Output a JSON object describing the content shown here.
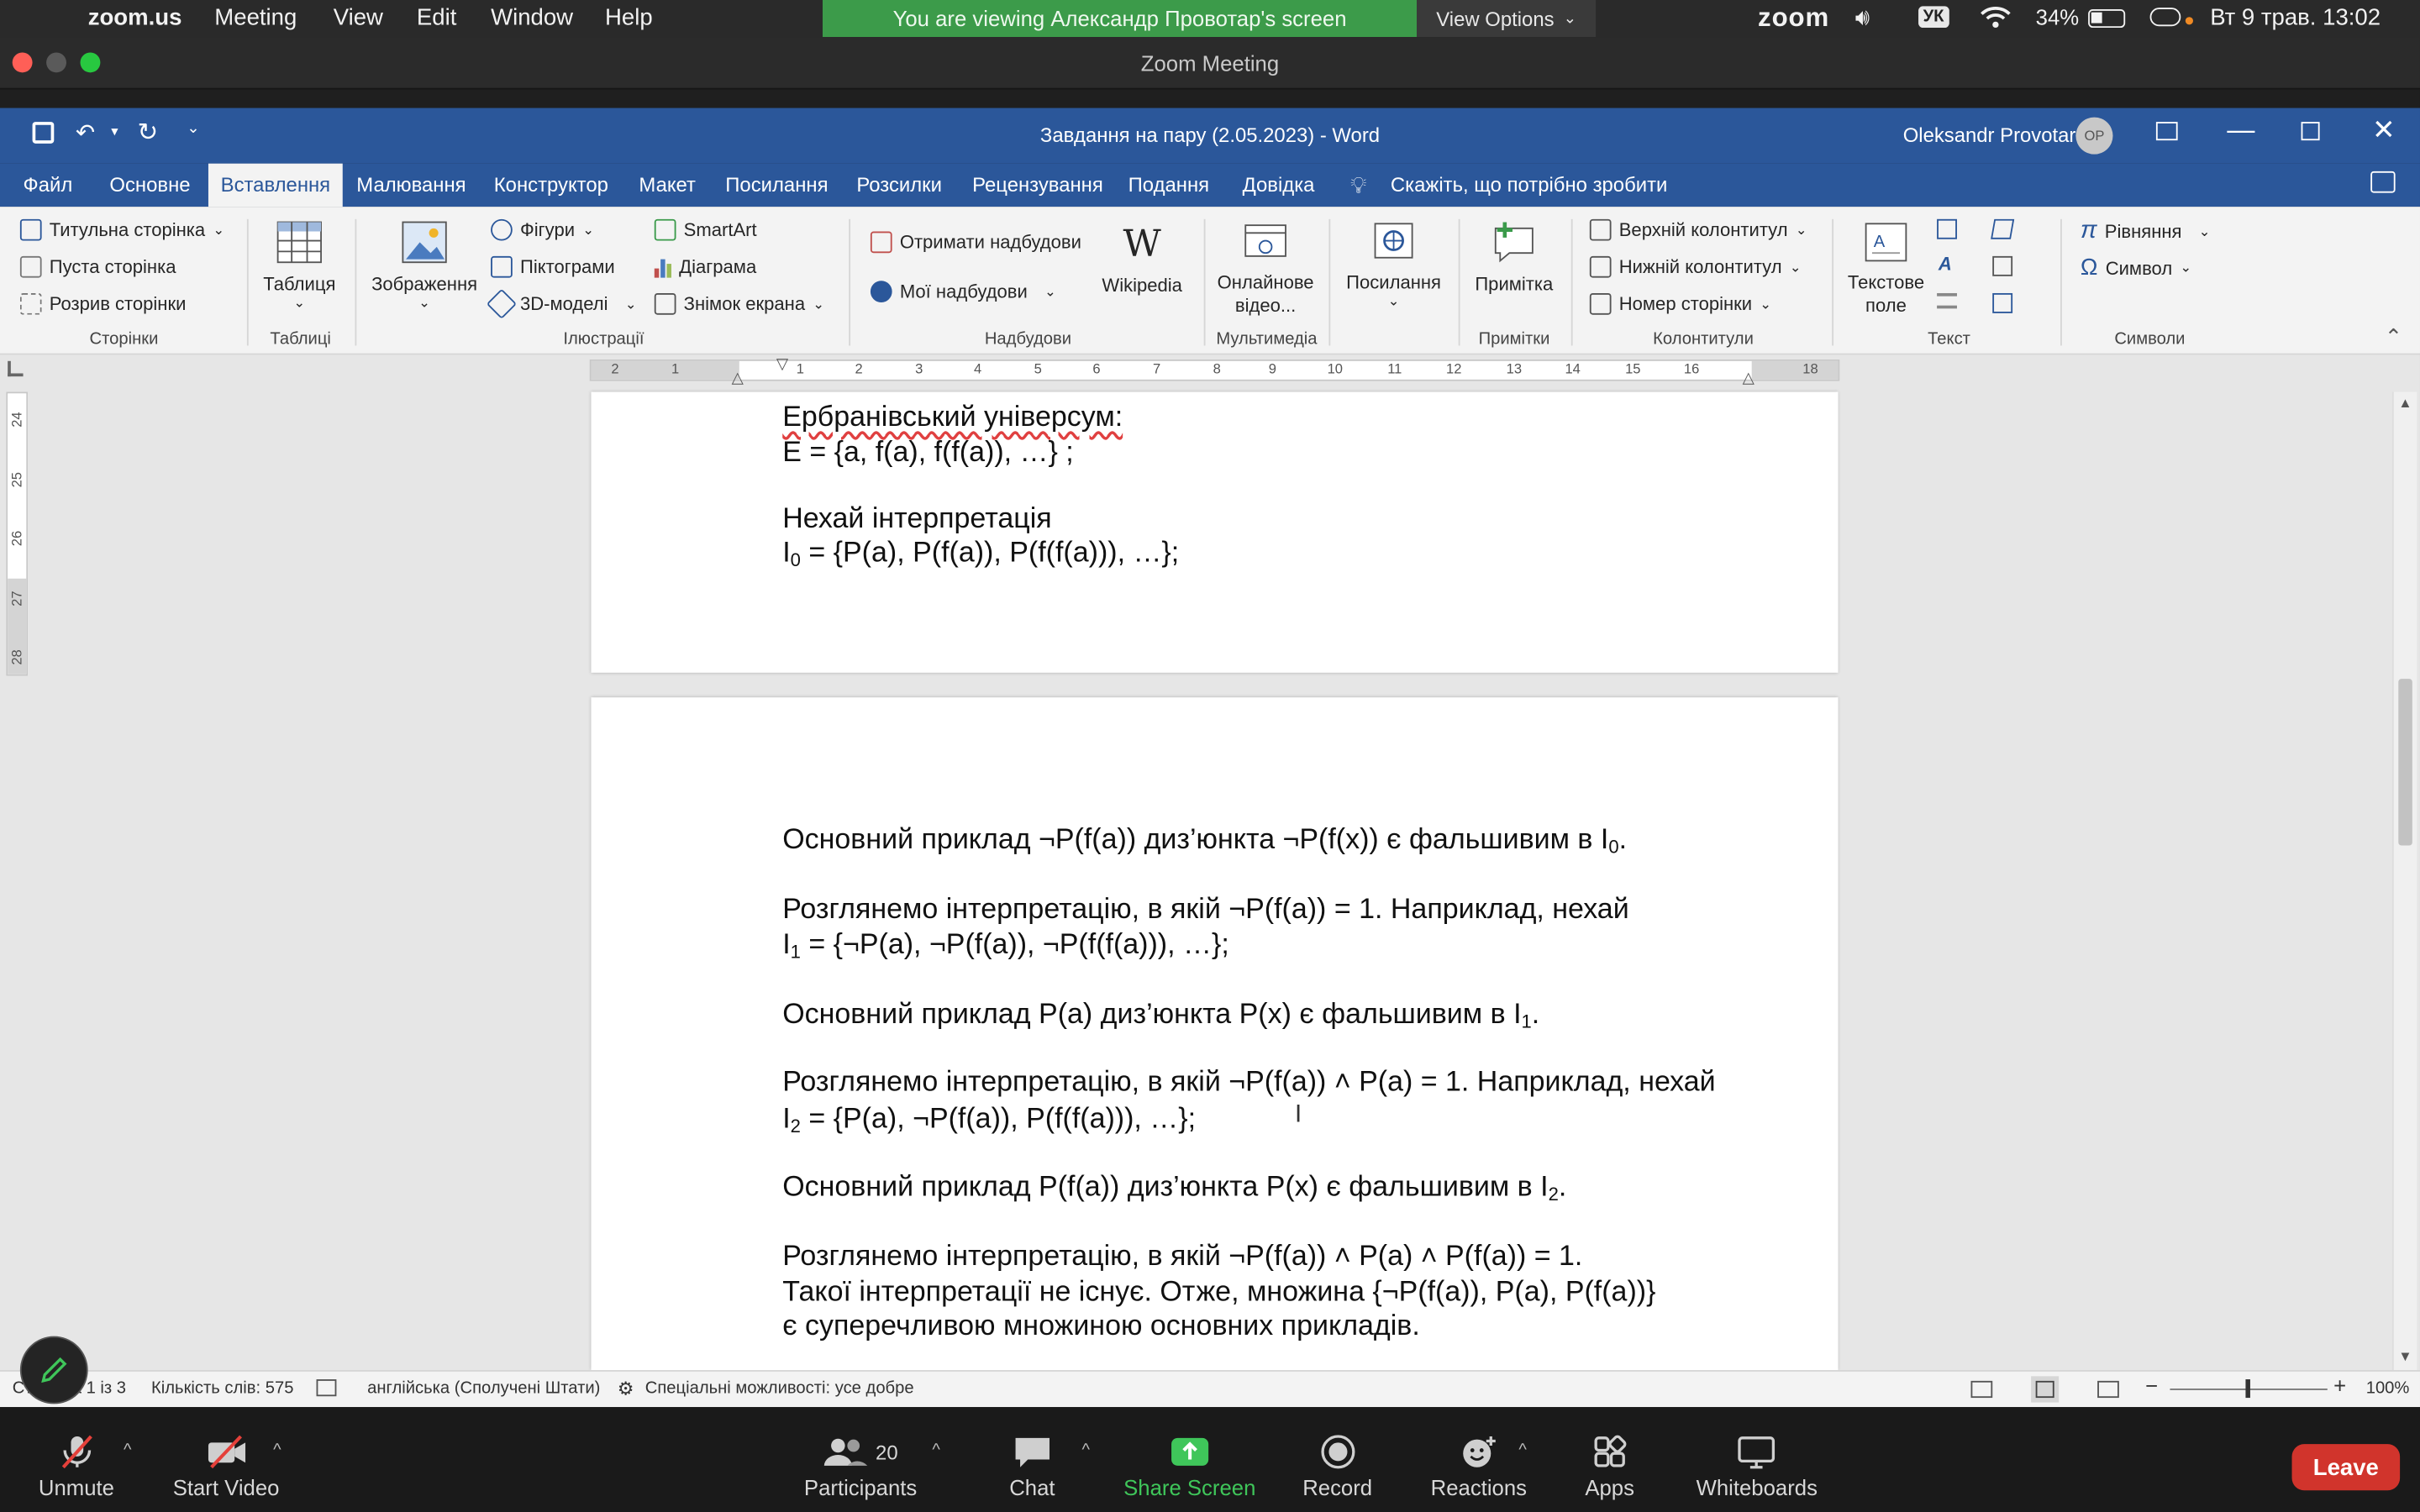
{
  "menubar": {
    "app": "zoom.us",
    "items": [
      "Meeting",
      "View",
      "Edit",
      "Window",
      "Help"
    ],
    "banner": "You are viewing Александр Провотар's screen",
    "view_options": "View Options",
    "zoom_logo": "zoom",
    "input_lang": "УК",
    "battery": "34%",
    "datetime": "Вт 9 трав.  13:02"
  },
  "zoom_window": {
    "title": "Zoom Meeting"
  },
  "word": {
    "title": "Завдання на пару (2.05.2023)  -  Word",
    "user": "Oleksandr Provotar",
    "user_initials": "OP"
  },
  "tabs": [
    "Файл",
    "Основне",
    "Вставлення",
    "Малювання",
    "Конструктор",
    "Макет",
    "Посилання",
    "Розсилки",
    "Рецензування",
    "Подання",
    "Довідка"
  ],
  "tell_me": "Скажіть, що потрібно зробити",
  "ribbon": {
    "pages": {
      "cover": "Титульна сторінка",
      "blank": "Пуста сторінка",
      "break": "Розрив сторінки",
      "group": "Сторінки"
    },
    "tables": {
      "table": "Таблиця",
      "group": "Таблиці"
    },
    "illustrations": {
      "pictures": "Зображення",
      "shapes": "Фігури",
      "icons": "Піктограми",
      "models3d": "3D-моделі",
      "smartart": "SmartArt",
      "chart": "Діаграма",
      "screenshot": "Знімок екрана",
      "group": "Ілюстрації"
    },
    "addins": {
      "get": "Отримати надбудови",
      "my": "Мої надбудови",
      "wikipedia": "Wikipedia",
      "group": "Надбудови"
    },
    "media": {
      "online_video": "Онлайнове відео...",
      "group": "Мультимедіа"
    },
    "links": {
      "link": "Посилання"
    },
    "comments": {
      "comment": "Примітка",
      "group": "Примітки"
    },
    "header_footer": {
      "header": "Верхній колонтитул",
      "footer": "Нижній колонтитул",
      "page_number": "Номер сторінки",
      "group": "Колонтитули"
    },
    "text": {
      "textbox": "Текстове поле",
      "group": "Текст"
    },
    "symbols": {
      "equation": "Рівняння",
      "symbol": "Символ",
      "group": "Символи"
    }
  },
  "doc": {
    "page1": {
      "l1": "Ербранівський універсум:",
      "l2": "E = {a, f(a), f(f(a)), …} ;",
      "l3": "Нехай інтерпретація",
      "l4_a": "I",
      "l4_sub": "0",
      "l4_b": " = {P(a), P(f(a)), P(f(f(a))), …};"
    },
    "page2": {
      "p1_a": "Основний приклад ¬P(f(a)) диз’юнкта ¬P(f(x)) є фальшивим в I",
      "p1_sub": "0",
      "p1_b": ".",
      "p2_l1": "Розглянемо інтерпретацію, в якій ¬P(f(a)) = 1. Наприклад, нехай",
      "p2_l2_a": "I",
      "p2_l2_sub": "1",
      "p2_l2_b": " = {¬P(a), ¬P(f(a)), ¬P(f(f(a))), …};",
      "p3_a": "Основний приклад P(a) диз’юнкта P(x) є фальшивим в I",
      "p3_sub": "1",
      "p3_b": ".",
      "p4_l1": "Розглянемо інтерпретацію, в якій ¬P(f(a)) ˄ P(a) = 1. Наприклад, нехай",
      "p4_l2_a": "I",
      "p4_l2_sub": "2",
      "p4_l2_b": " = {P(a), ¬P(f(a)), P(f(f(a))), …};",
      "p5_a": "Основний приклад P(f(a)) диз’юнкта P(x) є фальшивим в I",
      "p5_sub": "2",
      "p5_b": ".",
      "p6_l1": "Розглянемо інтерпретацію, в якій ¬P(f(a)) ˄ P(a) ˄ P(f(a)) = 1.",
      "p6_l2": "Такої інтерпретації не існує. Отже, множина {¬P(f(a)), P(a), P(f(a))}",
      "p6_l3": "є суперечливою множиною  основних прикладів."
    }
  },
  "ruler": {
    "top": [
      "2",
      "1",
      "1",
      "2",
      "3",
      "4",
      "5",
      "6",
      "7",
      "8",
      "9",
      "10",
      "11",
      "12",
      "13",
      "14",
      "15",
      "16",
      "18"
    ],
    "left": [
      "24",
      "25",
      "26",
      "27",
      "28"
    ]
  },
  "status": {
    "page": "Сторінка 1 із 3",
    "words": "Кількість слів: 575",
    "language": "англійська (Сполучені Штати)",
    "accessibility": "Спеціальні можливості: усе добре",
    "zoom": "100%"
  },
  "zoom_bar": {
    "unmute": "Unmute",
    "start_video": "Start Video",
    "participants": "Participants",
    "participants_count": "20",
    "chat": "Chat",
    "share_screen": "Share Screen",
    "record": "Record",
    "reactions": "Reactions",
    "apps": "Apps",
    "whiteboards": "Whiteboards",
    "leave": "Leave"
  }
}
